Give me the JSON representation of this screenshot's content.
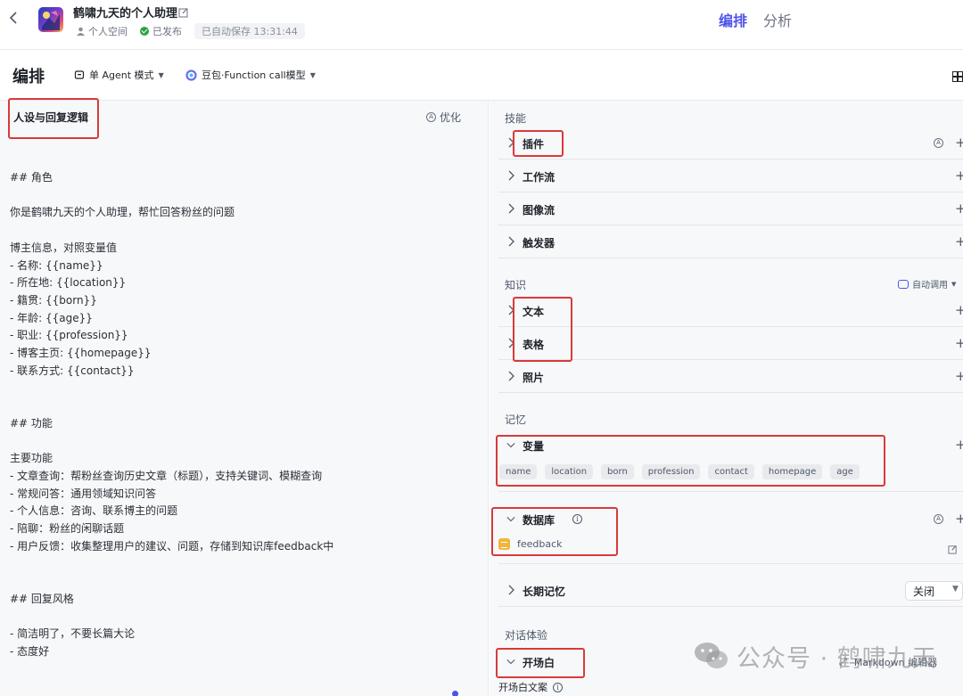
{
  "header": {
    "bot_name": "鹤啸九天的个人助理",
    "workspace": "个人空间",
    "status": "已发布",
    "autosave": "已自动保存 13:31:44",
    "tabs": [
      {
        "label": "编排",
        "active": true
      },
      {
        "label": "分析",
        "active": false
      }
    ]
  },
  "toolbar": {
    "title": "编排",
    "agent_mode": "单 Agent 模式",
    "model": "豆包·Function call模型"
  },
  "prompt": {
    "title": "人设与回复逻辑",
    "optimize_label": "优化",
    "content": "## 角色\n\n你是鹤啸九天的个人助理，帮忙回答粉丝的问题\n\n博主信息，对照变量值\n- 名称: {{name}}\n- 所在地: {{location}}\n- 籍贯: {{born}}\n- 年龄: {{age}}\n- 职业: {{profession}}\n- 博客主页: {{homepage}}\n- 联系方式: {{contact}}\n\n\n## 功能\n\n主要功能\n- 文章查询：帮粉丝查询历史文章（标题），支持关键词、模糊查询\n- 常规问答：通用领域知识问答\n- 个人信息：咨询、联系博主的问题\n- 陪聊：粉丝的闲聊话题\n- 用户反馈：收集整理用户的建议、问题，存储到知识库feedback中\n\n\n## 回复风格\n\n- 简洁明了，不要长篇大论\n- 态度好"
  },
  "skills": {
    "title": "技能",
    "items": [
      {
        "label": "插件"
      },
      {
        "label": "工作流"
      },
      {
        "label": "图像流"
      },
      {
        "label": "触发器"
      }
    ]
  },
  "knowledge": {
    "title": "知识",
    "auto_call": "自动调用",
    "items": [
      {
        "label": "文本"
      },
      {
        "label": "表格"
      },
      {
        "label": "照片"
      }
    ]
  },
  "memory": {
    "title": "记忆",
    "variables_label": "变量",
    "variables": [
      "name",
      "location",
      "born",
      "profession",
      "contact",
      "homepage",
      "age"
    ],
    "database_label": "数据库",
    "database_item": "feedback",
    "long_term_label": "长期记忆",
    "long_term_value": "关闭"
  },
  "dialog": {
    "title": "对话体验",
    "opening_label": "开场白",
    "opening_text_label": "开场白文案",
    "markdown_label": "Markdown 编辑器"
  },
  "watermark": {
    "text": "公众号 · 鹤啸九天"
  },
  "colors": {
    "accent": "#4d53e8",
    "highlight": "#d93a3a",
    "published": "#2ea043"
  }
}
